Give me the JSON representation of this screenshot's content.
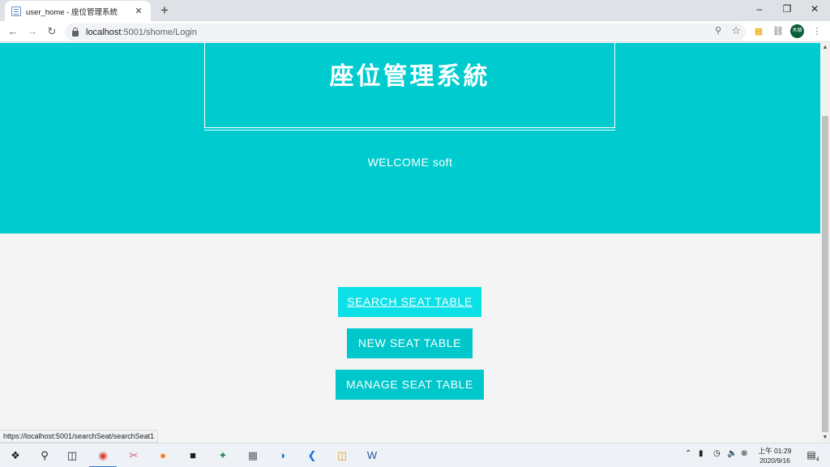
{
  "browser": {
    "tab_title": "user_home - 座位管理系統",
    "tab_close": "✕",
    "new_tab": "+",
    "url_host": "localhost",
    "url_rest": ":5001/shome/Login",
    "window_controls": [
      "–",
      "❐",
      "✕"
    ],
    "avatar_text": "木頭"
  },
  "page": {
    "site_title": "座位管理系統",
    "welcome": "WELCOME soft",
    "buttons": {
      "search": "SEARCH SEAT TABLE",
      "new": "NEW SEAT TABLE",
      "manage": "MANAGE SEAT TABLE"
    }
  },
  "status_bar": {
    "hover_url": "https://localhost:5001/searchSeat/searchSeat1"
  },
  "taskbar": {
    "time": "上午 01:29",
    "date": "2020/9/16",
    "notification_count": "4"
  },
  "colors": {
    "hero_bg": "#00cccf",
    "button_bg": "#00c7cc",
    "button_active_bg": "#0ae0e6",
    "page_bg": "#f4f4f4"
  },
  "icons": [
    "file-icon",
    "back-arrow-icon",
    "forward-arrow-icon",
    "reload-icon",
    "lock-icon",
    "zoom-icon",
    "star-icon",
    "extension-icon",
    "puzzle-icon",
    "more-icon",
    "windows-start-icon",
    "search-icon",
    "task-view-icon"
  ]
}
